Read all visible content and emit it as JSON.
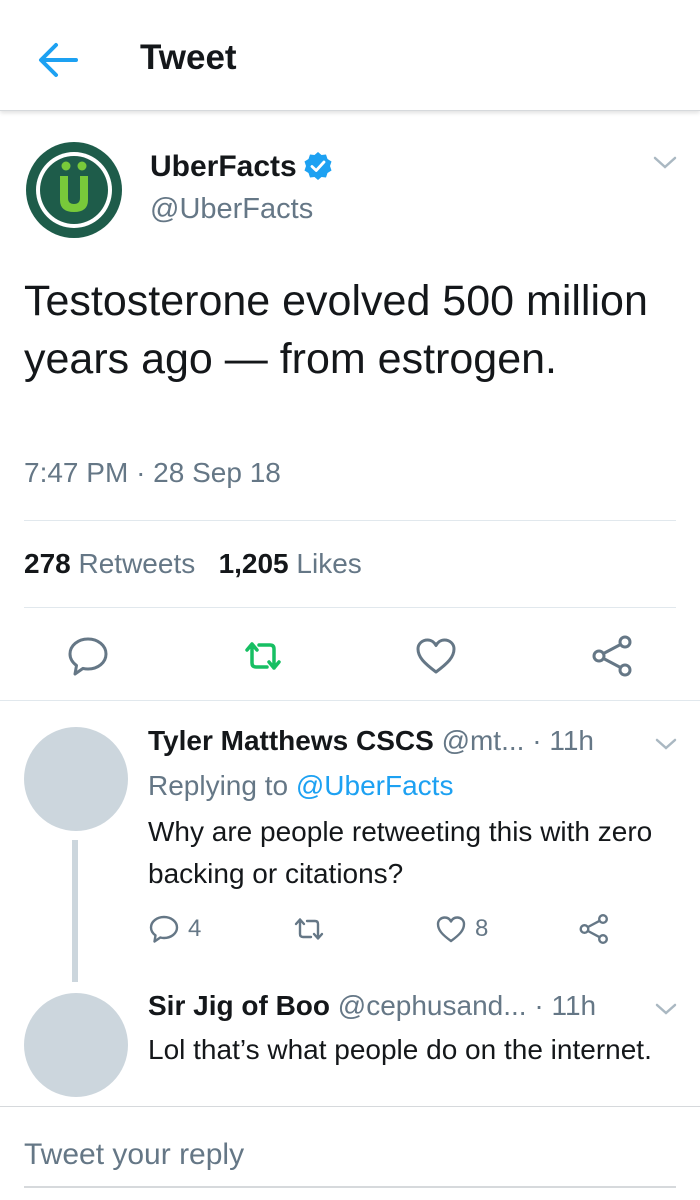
{
  "header": {
    "title": "Tweet"
  },
  "tweet": {
    "author_name": "UberFacts",
    "author_handle": "@UberFacts",
    "avatar_letter": "Ü",
    "text": "Testosterone evolved 500 million years ago — from estrogen.",
    "time": "7:47 PM",
    "separator": "·",
    "date": "28 Sep 18",
    "retweet_count": "278",
    "retweet_label": "Retweets",
    "like_count": "1,205",
    "like_label": "Likes",
    "colors": {
      "brand_green": "#78c93a",
      "avatar_ring": "#1e5c4a",
      "retweet_green": "#17bf63",
      "accent_blue": "#1da1f2"
    }
  },
  "replies": [
    {
      "name": "Tyler Matthews CSCS",
      "handle": "@mt...",
      "time": "· 11h",
      "replying_prefix": "Replying to",
      "replying_to": "@UberFacts",
      "text": "Why are people retweeting this with zero backing or citations?",
      "reply_count": "4",
      "like_count": "8"
    },
    {
      "name": "Sir Jig of Boo",
      "handle": "@cephusand...",
      "time": "· 11h",
      "text": "Lol that’s what people do on the internet."
    }
  ],
  "composer": {
    "placeholder": "Tweet your reply"
  }
}
